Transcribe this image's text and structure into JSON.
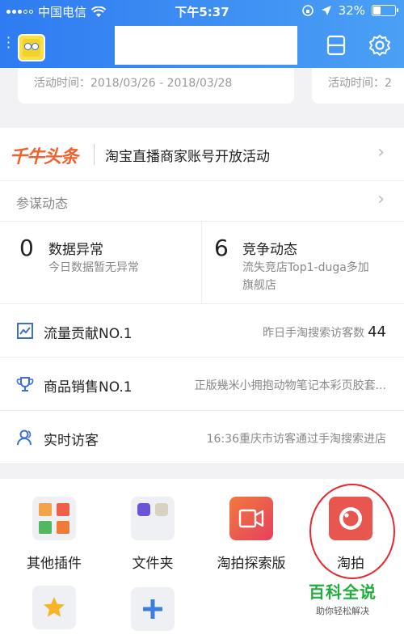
{
  "status_bar": {
    "carrier": "中国电信",
    "time": "下午5:37",
    "battery": "32%",
    "battery_level": 0.32
  },
  "header": {
    "menu_icon": "more-dots-icon",
    "avatar_icon": "spongebob-avatar",
    "scan_icon": "scan-icon",
    "settings_icon": "gear-icon"
  },
  "activity_strip": {
    "cards": [
      {
        "label": "活动时间：2018/03/26 - 2018/03/28"
      },
      {
        "label": "活动时间：2"
      }
    ]
  },
  "headline": {
    "logo": "千牛头条",
    "text": "淘宝直播商家账号开放活动"
  },
  "canmou": {
    "title": "参谋动态"
  },
  "stats": [
    {
      "num": "0",
      "title": "数据异常",
      "desc": "今日数据暂无异常"
    },
    {
      "num": "6",
      "title": "竞争动态",
      "desc_line1": "流失竞店Top1-duga多加",
      "desc_line2": "旗舰店"
    }
  ],
  "rows": [
    {
      "icon": "trend-chart-icon",
      "label": "流量贡献NO.1",
      "value": "昨日手淘搜索访客数",
      "value_num": "44"
    },
    {
      "icon": "trophy-icon",
      "label": "商品销售NO.1",
      "value": "正版幾米小拥抱动物笔记本彩页胶套..."
    },
    {
      "icon": "user-icon",
      "label": "实时访客",
      "value": "16:36重庆市访客通过手淘搜索进店"
    }
  ],
  "plugins": [
    {
      "name": "其他插件",
      "icon": "plugin-grid-icon"
    },
    {
      "name": "文件夹",
      "icon": "folder-icon"
    },
    {
      "name": "淘拍探索版",
      "icon": "video-camera-icon"
    },
    {
      "name": "淘拍",
      "icon": "camera-icon"
    },
    {
      "name": "",
      "icon": "star-icon"
    },
    {
      "name": "",
      "icon": "plus-icon"
    }
  ],
  "watermark": {
    "big": "百科全说",
    "small": "助你轻松解决"
  },
  "colors": {
    "header_start": "#2f7bf1",
    "header_end": "#4aa0f5",
    "accent_orange": "#f0602b",
    "icon_blue": "#3b6fd6",
    "highlight_red": "#e8262e",
    "watermark_green": "#1fae3c"
  }
}
